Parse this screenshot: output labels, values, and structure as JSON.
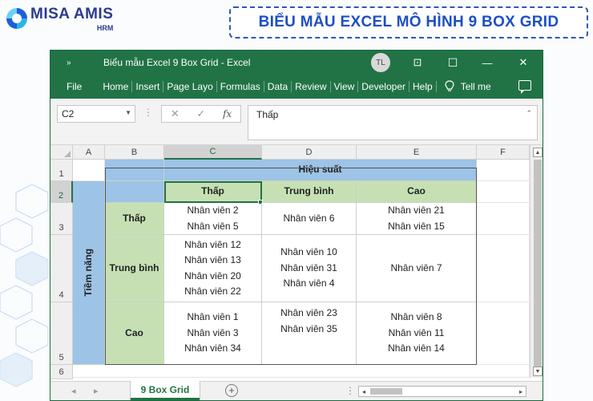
{
  "brand": {
    "name": "MISA AMIS",
    "sub": "HRM"
  },
  "banner": {
    "title": "BIỂU MẪU EXCEL MÔ HÌNH 9 BOX GRID"
  },
  "window": {
    "title": "Biểu mẫu Excel 9 Box Grid  -  Excel",
    "user_initials": "TL",
    "qat_icon": "»",
    "controls": {
      "ribbon_toggle": "⊡",
      "minimize": "—",
      "maximize": "☐",
      "close": "✕"
    }
  },
  "ribbon": {
    "file": "File",
    "tabs": [
      "Home",
      "Insert",
      "Page Layo",
      "Formulas",
      "Data",
      "Review",
      "View",
      "Developer",
      "Help"
    ],
    "tell_me": "Tell me",
    "bulb_icon": "lightbulb-icon",
    "comment_icon": "comment-icon",
    "theme_color": "#217346"
  },
  "formula_bar": {
    "name_box": "C2",
    "fx": "fx",
    "cancel": "✕",
    "enter": "✓",
    "content": "Thấp"
  },
  "grid": {
    "columns": [
      "A",
      "B",
      "C",
      "D",
      "E",
      "F"
    ],
    "rows": [
      "1",
      "2",
      "3",
      "4",
      "5",
      "6"
    ],
    "x_axis_title": "Hiệu suất",
    "y_axis_title": "Tiềm năng",
    "col_labels": [
      "Thấp",
      "Trung bình",
      "Cao"
    ],
    "row_labels": [
      "Thấp",
      "Trung bình",
      "Cao"
    ],
    "cells": [
      [
        [
          "Nhân viên 2",
          "Nhân viên 5"
        ],
        [
          "Nhân viên 6"
        ],
        [
          "Nhân viên 21",
          "Nhân viên 15"
        ]
      ],
      [
        [
          "Nhân viên 12",
          "Nhân viên 13",
          "Nhân viên 20",
          "Nhân viên 22"
        ],
        [
          "Nhân viên 10",
          "Nhân viên 31",
          "Nhân viên 4"
        ],
        [
          "Nhân viên 7"
        ]
      ],
      [
        [
          "Nhân viên 1",
          "Nhân viên 3",
          "Nhân viên 34"
        ],
        [
          "Nhân viên 23",
          "Nhân viên 35"
        ],
        [
          "Nhân viên 8",
          "Nhân viên 11",
          "Nhân viên 14"
        ]
      ]
    ],
    "colors": {
      "header_blue": "#9dc3e6",
      "header_green": "#c6e0b4"
    }
  },
  "sheets": {
    "active": "9 Box Grid",
    "add": "+"
  }
}
